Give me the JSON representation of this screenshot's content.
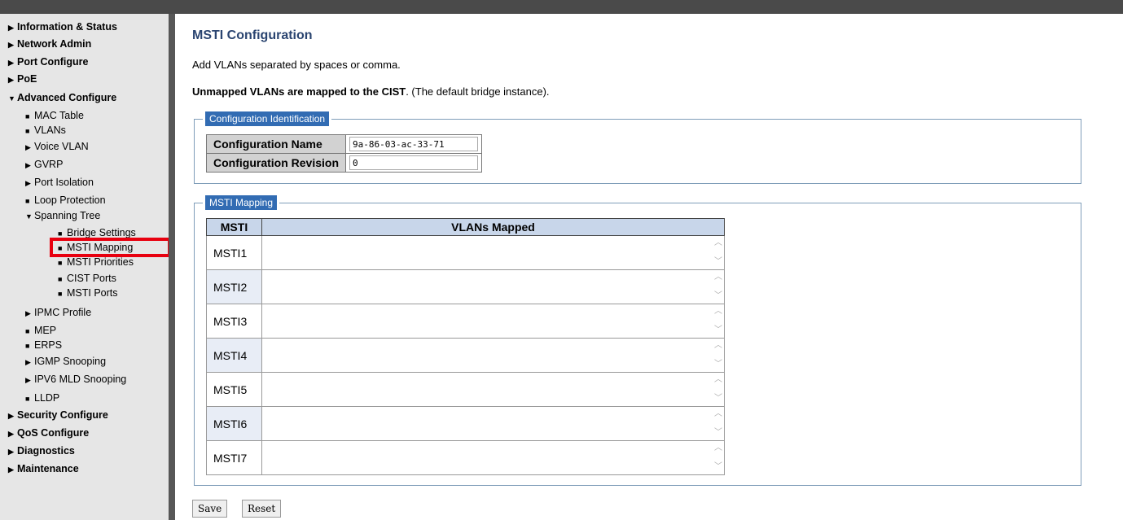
{
  "sidebar": {
    "items": [
      {
        "label": "Information & Status",
        "marker": "▶"
      },
      {
        "label": "Network Admin",
        "marker": "▶"
      },
      {
        "label": "Port Configure",
        "marker": "▶"
      },
      {
        "label": "PoE",
        "marker": "▶"
      },
      {
        "label": "Advanced Configure",
        "marker": "▼"
      },
      {
        "label": "MAC Table",
        "marker": "■"
      },
      {
        "label": "VLANs",
        "marker": "■"
      },
      {
        "label": "Voice VLAN",
        "marker": "▶"
      },
      {
        "label": "GVRP",
        "marker": "▶"
      },
      {
        "label": "Port Isolation",
        "marker": "▶"
      },
      {
        "label": "Loop Protection",
        "marker": "■"
      },
      {
        "label": "Spanning Tree",
        "marker": "▼"
      },
      {
        "label": "Bridge Settings",
        "marker": "■"
      },
      {
        "label": "MSTI Mapping",
        "marker": "■"
      },
      {
        "label": "MSTI Priorities",
        "marker": "■"
      },
      {
        "label": "CIST Ports",
        "marker": "■"
      },
      {
        "label": "MSTI Ports",
        "marker": "■"
      },
      {
        "label": "IPMC Profile",
        "marker": "▶"
      },
      {
        "label": "MEP",
        "marker": "■"
      },
      {
        "label": "ERPS",
        "marker": "■"
      },
      {
        "label": "IGMP Snooping",
        "marker": "▶"
      },
      {
        "label": "IPV6 MLD Snooping",
        "marker": "▶"
      },
      {
        "label": "LLDP",
        "marker": "■"
      },
      {
        "label": "Security Configure",
        "marker": "▶"
      },
      {
        "label": "QoS Configure",
        "marker": "▶"
      },
      {
        "label": "Diagnostics",
        "marker": "▶"
      },
      {
        "label": "Maintenance",
        "marker": "▶"
      }
    ]
  },
  "page": {
    "title": "MSTI Configuration",
    "note1": "Add VLANs separated by spaces or comma.",
    "note2_bold": "Unmapped VLANs are mapped to the CIST",
    "note2_rest": ". (The default bridge instance)."
  },
  "config_id": {
    "legend": "Configuration Identification",
    "name_label": "Configuration Name",
    "name_value": "9a-86-03-ac-33-71",
    "revision_label": "Configuration Revision",
    "revision_value": "0"
  },
  "mapping": {
    "legend": "MSTI Mapping",
    "col_msti": "MSTI",
    "col_vlans": "VLANs Mapped",
    "rows": [
      "MSTI1",
      "MSTI2",
      "MSTI3",
      "MSTI4",
      "MSTI5",
      "MSTI6",
      "MSTI7"
    ]
  },
  "buttons": {
    "save": "Save",
    "reset": "Reset"
  },
  "colors": {
    "highlight": "#e8000f",
    "accent": "#326cb3",
    "title": "#2a4470"
  }
}
